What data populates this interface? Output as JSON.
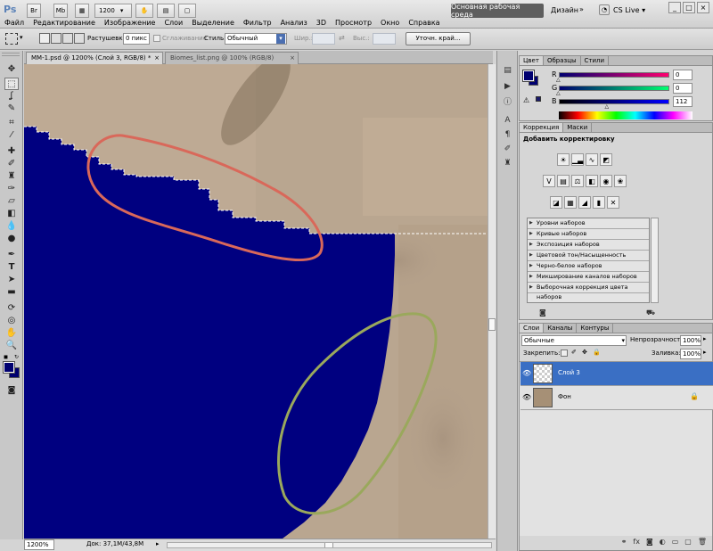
{
  "app": {
    "logo": "Ps",
    "zoom_dropdown": "1200",
    "workspace_button": "Основная рабочая среда",
    "design_link": "Дизайн",
    "cslive_label": "CS Live",
    "menu": [
      "Файл",
      "Редактирование",
      "Изображение",
      "Слои",
      "Выделение",
      "Фильтр",
      "Анализ",
      "3D",
      "Просмотр",
      "Окно",
      "Справка"
    ],
    "window_buttons": [
      "_",
      "□",
      "×"
    ]
  },
  "options": {
    "feather_label": "Растушевка:",
    "feather_value": "0 пикс",
    "antialias_label": "Сглаживание",
    "style_label": "Стиль:",
    "style_value": "Обычный",
    "width_label": "Шир.:",
    "height_label": "Выс.:",
    "refine_button": "Уточн. край..."
  },
  "tabs": [
    {
      "label": "MM-1.psd @ 1200% (Слой 3, RGB/8) *",
      "close": "×"
    },
    {
      "label": "Biomes_list.png @ 100% (RGB/8)",
      "close": "×"
    }
  ],
  "status": {
    "zoom": "1200%",
    "doc": "Док: 37,1M/43,8M"
  },
  "color_panel": {
    "tabs": [
      "Цвет",
      "Образцы",
      "Стили"
    ],
    "r_label": "R",
    "g_label": "G",
    "b_label": "B",
    "r_value": "0",
    "g_value": "0",
    "b_value": "112",
    "r_fraction": 0,
    "g_fraction": 0,
    "b_fraction": 0.44,
    "foreground_color": "#000070",
    "background_color": "#000070"
  },
  "adjustments_panel": {
    "tabs": [
      "Коррекция",
      "Маски"
    ],
    "title": "Добавить корректировку",
    "presets": [
      "Уровни наборов",
      "Кривые наборов",
      "Экспозиция наборов",
      "Цветовой тон/Насыщенность наборов",
      "Черно-белое наборов",
      "Микширование каналов наборов",
      "Выборочная коррекция цвета наборов"
    ]
  },
  "layers_panel": {
    "tabs": [
      "Слои",
      "Каналы",
      "Контуры"
    ],
    "blend_mode": "Обычные",
    "opacity_label": "Непрозрачность:",
    "opacity_value": "100%",
    "lock_label": "Закрепить:",
    "fill_label": "Заливка:",
    "fill_value": "100%",
    "layers": [
      {
        "name": "Слой 3",
        "selected": true
      },
      {
        "name": "Фон",
        "selected": false
      }
    ]
  },
  "colors": {
    "selection_fill": "#000080",
    "layer_selected": "#3a6fc4",
    "annotation_red": "#d9685a",
    "annotation_green": "#9aa85c"
  }
}
